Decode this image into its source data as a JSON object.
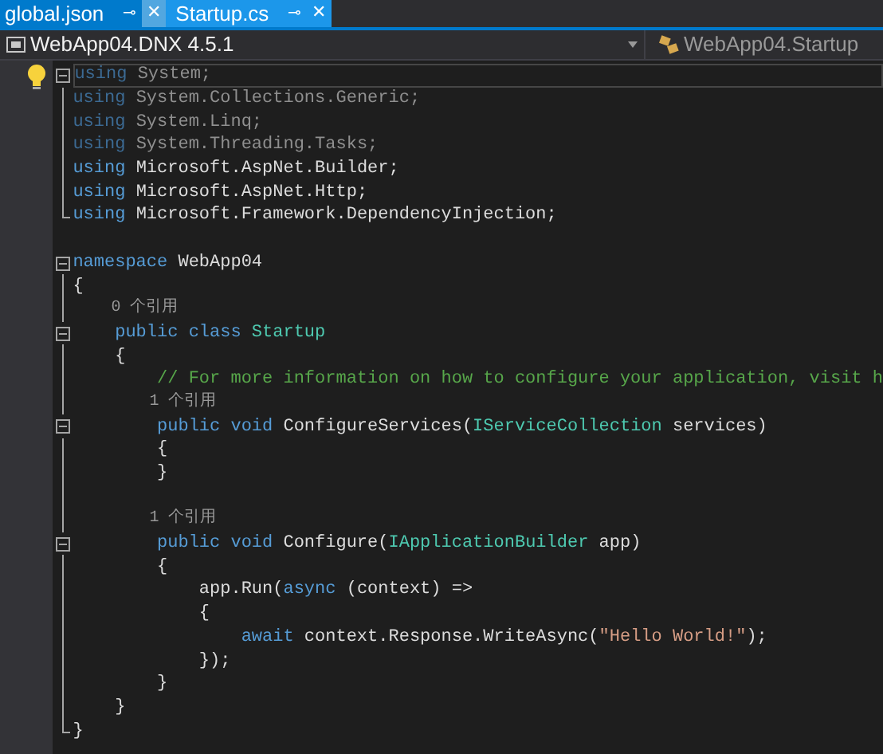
{
  "tabs": [
    {
      "label": "global.json",
      "selected": true,
      "pin": "⊸",
      "close": "✕"
    },
    {
      "label": "Startup.cs",
      "selected": false,
      "pin": "⊸",
      "close": "✕"
    }
  ],
  "navigation_bar": {
    "project": "WebApp04.DNX 4.5.1",
    "type": "WebApp04.Startup"
  },
  "code_lines": [
    {
      "kind": "code",
      "collapsible": true,
      "region_end": false,
      "current": true,
      "tokens": [
        {
          "kind": "keyword_dim",
          "text": "using"
        },
        {
          "kind": "plain_dim",
          "text": " System;"
        }
      ]
    },
    {
      "kind": "code",
      "collapsible": false,
      "region_end": false,
      "current": false,
      "tokens": [
        {
          "kind": "keyword_dim",
          "text": "using"
        },
        {
          "kind": "plain_dim",
          "text": " System.Collections.Generic;"
        }
      ]
    },
    {
      "kind": "code",
      "collapsible": false,
      "region_end": false,
      "current": false,
      "tokens": [
        {
          "kind": "keyword_dim",
          "text": "using"
        },
        {
          "kind": "plain_dim",
          "text": " System.Linq;"
        }
      ]
    },
    {
      "kind": "code",
      "collapsible": false,
      "region_end": false,
      "current": false,
      "tokens": [
        {
          "kind": "keyword_dim",
          "text": "using"
        },
        {
          "kind": "plain_dim",
          "text": " System.Threading.Tasks;"
        }
      ]
    },
    {
      "kind": "code",
      "collapsible": false,
      "region_end": false,
      "current": false,
      "tokens": [
        {
          "kind": "keyword",
          "text": "using"
        },
        {
          "kind": "plain",
          "text": " Microsoft.AspNet.Builder;"
        }
      ]
    },
    {
      "kind": "code",
      "collapsible": false,
      "region_end": false,
      "current": false,
      "tokens": [
        {
          "kind": "keyword",
          "text": "using"
        },
        {
          "kind": "plain",
          "text": " Microsoft.AspNet.Http;"
        }
      ]
    },
    {
      "kind": "code",
      "collapsible": false,
      "region_end": true,
      "current": false,
      "tokens": [
        {
          "kind": "keyword",
          "text": "using"
        },
        {
          "kind": "plain",
          "text": " Microsoft.Framework.DependencyInjection;"
        }
      ]
    },
    {
      "kind": "blank"
    },
    {
      "kind": "code",
      "collapsible": true,
      "region_end": false,
      "current": false,
      "tokens": [
        {
          "kind": "keyword",
          "text": "namespace"
        },
        {
          "kind": "plain",
          "text": " WebApp04"
        }
      ]
    },
    {
      "kind": "code",
      "collapsible": false,
      "region_end": false,
      "current": false,
      "tokens": [
        {
          "kind": "plain",
          "text": "{"
        }
      ]
    },
    {
      "kind": "codelens",
      "collapsible": false,
      "region_end": false,
      "current": false,
      "tokens": [
        {
          "kind": "codelens",
          "text": "    0 个引用"
        }
      ]
    },
    {
      "kind": "code",
      "collapsible": true,
      "region_end": false,
      "current": false,
      "tokens": [
        {
          "kind": "keyword",
          "text": "    public class"
        },
        {
          "kind": "type",
          "text": " Startup"
        }
      ]
    },
    {
      "kind": "code",
      "collapsible": false,
      "region_end": false,
      "current": false,
      "tokens": [
        {
          "kind": "plain",
          "text": "    {"
        }
      ]
    },
    {
      "kind": "code",
      "collapsible": false,
      "region_end": false,
      "current": false,
      "tokens": [
        {
          "kind": "comment",
          "text": "        // For more information on how to configure your application, visit h"
        }
      ]
    },
    {
      "kind": "codelens",
      "collapsible": false,
      "region_end": false,
      "current": false,
      "tokens": [
        {
          "kind": "codelens",
          "text": "        1 个引用"
        }
      ]
    },
    {
      "kind": "code",
      "collapsible": true,
      "region_end": false,
      "current": false,
      "tokens": [
        {
          "kind": "keyword",
          "text": "        public void"
        },
        {
          "kind": "plain",
          "text": " ConfigureServices("
        },
        {
          "kind": "type",
          "text": "IServiceCollection"
        },
        {
          "kind": "plain",
          "text": " services)"
        }
      ]
    },
    {
      "kind": "code",
      "collapsible": false,
      "region_end": false,
      "current": false,
      "tokens": [
        {
          "kind": "plain",
          "text": "        {"
        }
      ]
    },
    {
      "kind": "code",
      "collapsible": false,
      "region_end": false,
      "current": false,
      "tokens": [
        {
          "kind": "plain",
          "text": "        }"
        }
      ]
    },
    {
      "kind": "blank"
    },
    {
      "kind": "codelens",
      "collapsible": false,
      "region_end": false,
      "current": false,
      "tokens": [
        {
          "kind": "codelens",
          "text": "        1 个引用"
        }
      ]
    },
    {
      "kind": "code",
      "collapsible": true,
      "region_end": false,
      "current": false,
      "tokens": [
        {
          "kind": "keyword",
          "text": "        public void"
        },
        {
          "kind": "plain",
          "text": " Configure("
        },
        {
          "kind": "type",
          "text": "IApplicationBuilder"
        },
        {
          "kind": "plain",
          "text": " app)"
        }
      ]
    },
    {
      "kind": "code",
      "collapsible": false,
      "region_end": false,
      "current": false,
      "tokens": [
        {
          "kind": "plain",
          "text": "        {"
        }
      ]
    },
    {
      "kind": "code",
      "collapsible": false,
      "region_end": false,
      "current": false,
      "tokens": [
        {
          "kind": "plain",
          "text": "            app.Run("
        },
        {
          "kind": "keyword",
          "text": "async"
        },
        {
          "kind": "plain",
          "text": " (context) =>"
        }
      ]
    },
    {
      "kind": "code",
      "collapsible": false,
      "region_end": false,
      "current": false,
      "tokens": [
        {
          "kind": "plain",
          "text": "            {"
        }
      ]
    },
    {
      "kind": "code",
      "collapsible": false,
      "region_end": false,
      "current": false,
      "tokens": [
        {
          "kind": "keyword",
          "text": "                await"
        },
        {
          "kind": "plain",
          "text": " context.Response.WriteAsync("
        },
        {
          "kind": "string",
          "text": "\"Hello World!\""
        },
        {
          "kind": "plain",
          "text": ");"
        }
      ]
    },
    {
      "kind": "code",
      "collapsible": false,
      "region_end": false,
      "current": false,
      "tokens": [
        {
          "kind": "plain",
          "text": "            });"
        }
      ]
    },
    {
      "kind": "code",
      "collapsible": false,
      "region_end": false,
      "current": false,
      "tokens": [
        {
          "kind": "plain",
          "text": "        }"
        }
      ]
    },
    {
      "kind": "code",
      "collapsible": false,
      "region_end": false,
      "current": false,
      "tokens": [
        {
          "kind": "plain",
          "text": "    }"
        }
      ]
    },
    {
      "kind": "code",
      "collapsible": false,
      "region_end": true,
      "current": false,
      "tokens": [
        {
          "kind": "plain",
          "text": "}"
        }
      ]
    }
  ]
}
